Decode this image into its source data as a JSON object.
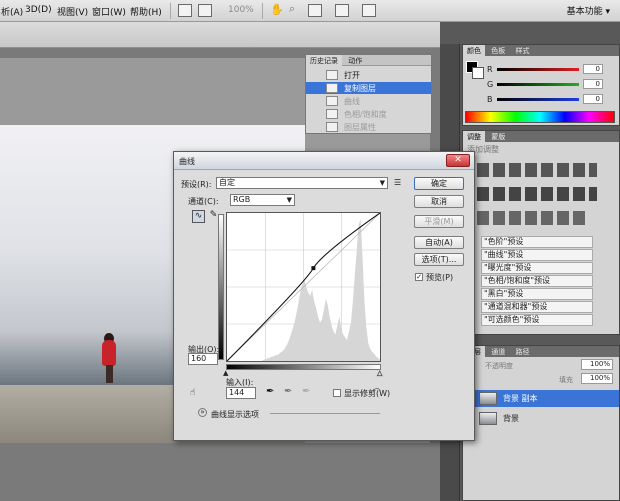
{
  "menubar": {
    "items": [
      "析(A)",
      "3D(D)",
      "视图(V)",
      "窗口(W)",
      "帮助(H)"
    ],
    "zoom": "100%",
    "workspace": "基本功能"
  },
  "history_panel": {
    "tabs": [
      "历史记录",
      "动作"
    ],
    "rows": [
      {
        "label": "打开",
        "state": "normal"
      },
      {
        "label": "复制图层",
        "state": "selected"
      },
      {
        "label": "曲线",
        "state": "dim"
      },
      {
        "label": "色相/饱和度",
        "state": "dim"
      },
      {
        "label": "图层属性",
        "state": "dim"
      }
    ]
  },
  "color_panel": {
    "tabs": [
      "颜色",
      "色板",
      "样式"
    ],
    "channels": [
      {
        "label": "R",
        "value": "0",
        "color": "#e02020"
      },
      {
        "label": "G",
        "value": "0",
        "color": "#20b020"
      },
      {
        "label": "B",
        "value": "0",
        "color": "#2040e0"
      }
    ]
  },
  "adjustments_panel": {
    "tabs": [
      "调整",
      "蒙版"
    ],
    "subtitle": "添加调整",
    "presets": [
      "\"色阶\"预设",
      "\"曲线\"预设",
      "\"曝光度\"预设",
      "\"色相/饱和度\"预设",
      "\"黑白\"预设",
      "\"通道混和器\"预设",
      "\"可选颜色\"预设"
    ]
  },
  "layers_panel": {
    "tabs": [
      "图层",
      "通道",
      "路径"
    ],
    "blend_mode": "",
    "opacity_label": "不透明度",
    "opacity_value": "100%",
    "fill_label": "填充",
    "fill_value": "100%",
    "layers": [
      {
        "name": "背景 副本",
        "selected": true
      },
      {
        "name": "背景",
        "selected": false
      }
    ]
  },
  "curves_dialog": {
    "title": "曲线",
    "preset_label": "预设(R):",
    "preset_value": "自定",
    "channel_label": "通道(C):",
    "channel_value": "RGB",
    "buttons": {
      "ok": "确定",
      "cancel": "取消",
      "smooth": "平滑(M)",
      "auto": "自动(A)",
      "options": "选项(T)...",
      "preview": "预览(P)"
    },
    "output_label": "输出(O):",
    "output_value": "160",
    "input_label": "输入(I):",
    "input_value": "144",
    "show_clipping_label": "显示修剪(W)",
    "display_options_label": "曲线显示选项",
    "curve_point": {
      "input": 144,
      "output": 160
    },
    "histogram": [
      0,
      0,
      0,
      0,
      0,
      0,
      0,
      0,
      0,
      0,
      0,
      0,
      0,
      0,
      0,
      0,
      0,
      0,
      0,
      1,
      1,
      2,
      2,
      3,
      3,
      4,
      4,
      5,
      6,
      7,
      9,
      11,
      14,
      18,
      22,
      27,
      33,
      40,
      48,
      52,
      55,
      50,
      46,
      44,
      48,
      40,
      36,
      30,
      26,
      28,
      34,
      42,
      38,
      30,
      24,
      20,
      18,
      24,
      30,
      22,
      18,
      16,
      14,
      20,
      26,
      40,
      58,
      75,
      92,
      96,
      70,
      40,
      22,
      12,
      8,
      6,
      5,
      3,
      2,
      1
    ],
    "curve_points": [
      [
        0,
        0
      ],
      [
        144,
        160
      ],
      [
        255,
        255
      ]
    ]
  }
}
